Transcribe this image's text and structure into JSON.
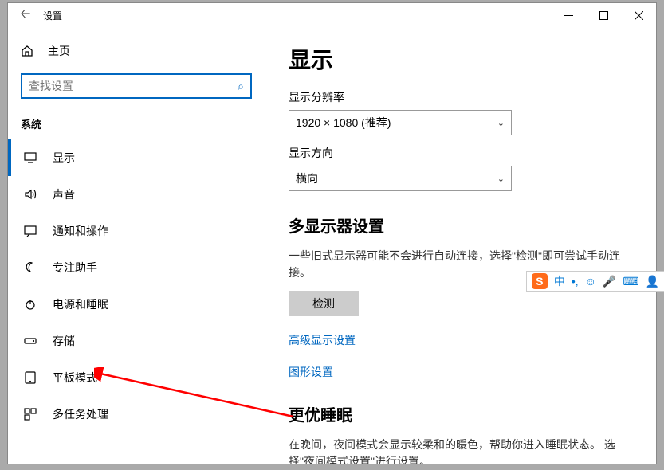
{
  "titlebar": {
    "title": "设置"
  },
  "sidebar": {
    "home": "主页",
    "search_placeholder": "查找设置",
    "section": "系统",
    "items": [
      {
        "label": "显示"
      },
      {
        "label": "声音"
      },
      {
        "label": "通知和操作"
      },
      {
        "label": "专注助手"
      },
      {
        "label": "电源和睡眠"
      },
      {
        "label": "存储"
      },
      {
        "label": "平板模式"
      },
      {
        "label": "多任务处理"
      }
    ]
  },
  "content": {
    "heading": "显示",
    "resolution_label": "显示分辨率",
    "resolution_value": "1920 × 1080 (推荐)",
    "orientation_label": "显示方向",
    "orientation_value": "横向",
    "multi_heading": "多显示器设置",
    "multi_desc": "一些旧式显示器可能不会进行自动连接，选择\"检测\"即可尝试手动连接。",
    "detect_btn": "检测",
    "link_advanced": "高级显示设置",
    "link_graphics": "图形设置",
    "sleep_heading": "更优睡眠",
    "sleep_desc": "在晚间，夜间模式会显示较柔和的暖色，帮助你进入睡眠状态。 选择\"夜间模式设置\"进行设置。"
  },
  "ime": {
    "lang": "中"
  }
}
